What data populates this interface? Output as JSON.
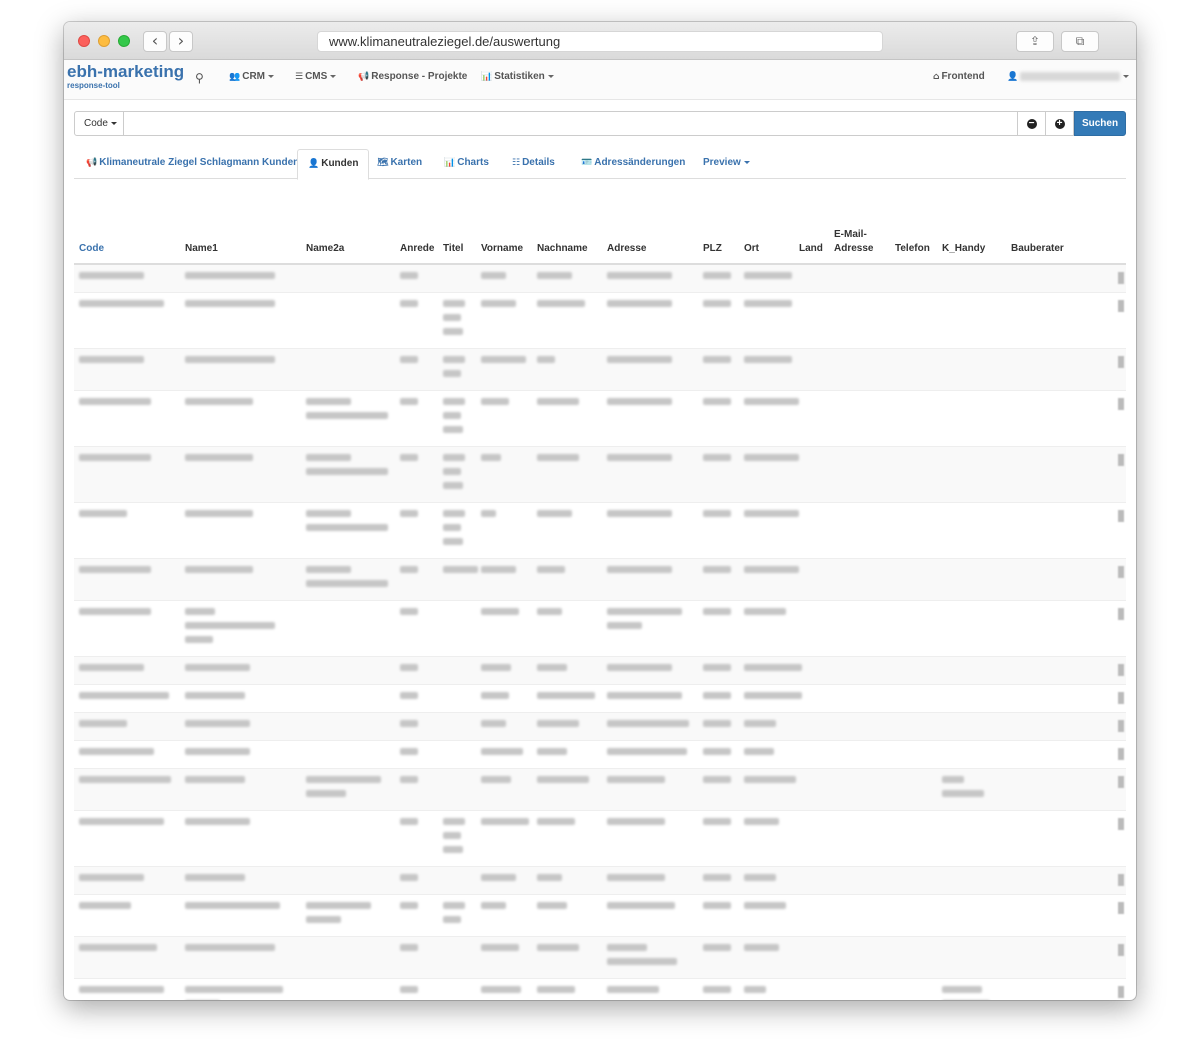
{
  "browser": {
    "url": "www.klimaneutraleziegel.de/auswertung",
    "back_icon": "‹",
    "forward_icon": "›",
    "share_icon": "⇪",
    "tabs_icon": "⧉"
  },
  "app": {
    "brand": "ebh-marketing",
    "brand_sub": "response-tool",
    "brand_color": "#3a72ad",
    "search_icon": "⚲",
    "nav": {
      "crm": "CRM",
      "cms": "CMS",
      "response": "Response - Projekte",
      "statistiken": "Statistiken",
      "frontend": "Frontend"
    }
  },
  "search": {
    "dropdown_label": "Code",
    "input_value": "",
    "minus_icon": "−",
    "plus_icon": "+",
    "button_label": "Suchen"
  },
  "tabs": [
    {
      "label": "Klimaneutrale Ziegel Schlagmann Kunden",
      "icon": "📢"
    },
    {
      "label": "Kunden",
      "icon": "👤"
    },
    {
      "label": "Karten",
      "icon": "🗺"
    },
    {
      "label": "Charts",
      "icon": "📊"
    },
    {
      "label": "Details",
      "icon": "☷"
    },
    {
      "label": "Adressänderungen",
      "icon": "🪪"
    },
    {
      "label": "Preview",
      "icon": ""
    }
  ],
  "table": {
    "headers": [
      "Code",
      "Name1",
      "Name2a",
      "Anrede",
      "Titel",
      "Vorname",
      "Nachname",
      "Adresse",
      "PLZ",
      "Ort",
      "Land",
      "E-Mail-Adresse",
      "Telefon",
      "K_Handy",
      "Bauberater"
    ]
  }
}
